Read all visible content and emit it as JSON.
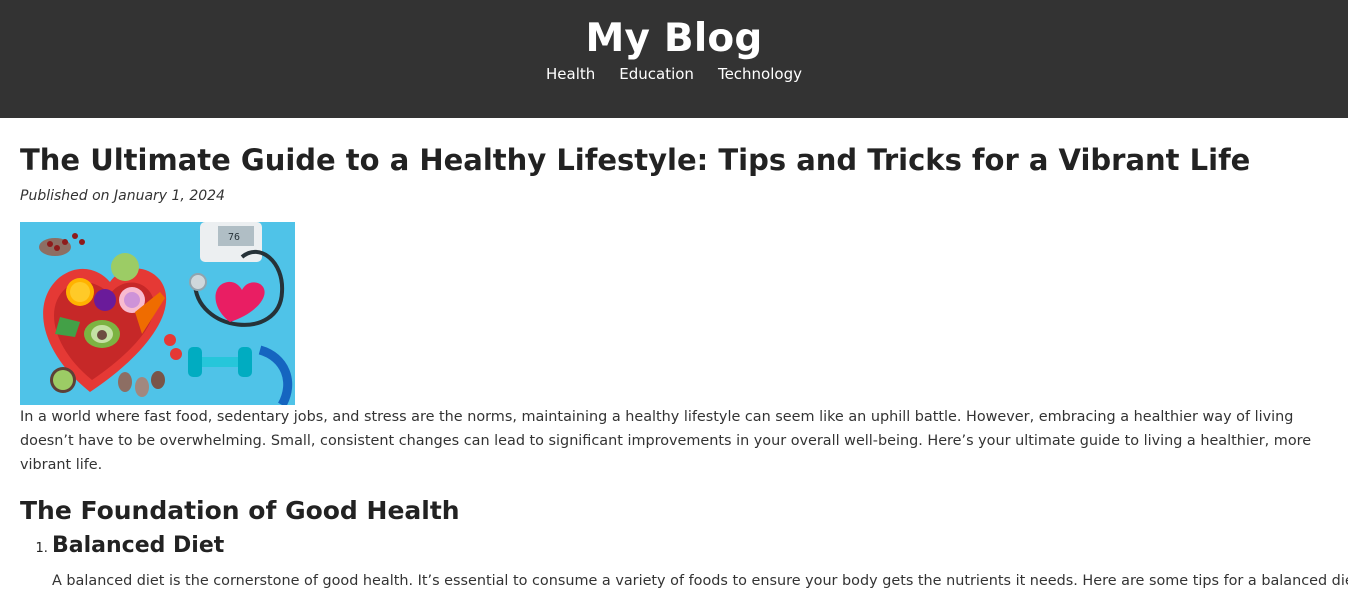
{
  "header": {
    "title": "My Blog",
    "nav": [
      {
        "label": "Health"
      },
      {
        "label": "Education"
      },
      {
        "label": "Technology"
      }
    ]
  },
  "article": {
    "title": "The Ultimate Guide to a Healthy Lifestyle: Tips and Tricks for a Vibrant Life",
    "published": "Published on January 1, 2024",
    "intro": "In a world where fast food, sedentary jobs, and stress are the norms, maintaining a healthy lifestyle can seem like an uphill battle. However, embracing a healthier way of living doesn’t have to be overwhelming. Small, consistent changes can lead to significant improvements in your overall well-being. Here’s your ultimate guide to living a healthier, more vibrant life.",
    "section": {
      "title": "The Foundation of Good Health",
      "items": [
        {
          "title": "Balanced Diet",
          "text": "A balanced diet is the cornerstone of good health. It’s essential to consume a variety of foods to ensure your body gets the nutrients it needs. Here are some tips for a balanced diet:"
        }
      ]
    }
  },
  "colors": {
    "header_bg": "#333333",
    "header_text": "#ffffff",
    "body_text": "#222222",
    "hero_bg": "#4fc3e8"
  }
}
